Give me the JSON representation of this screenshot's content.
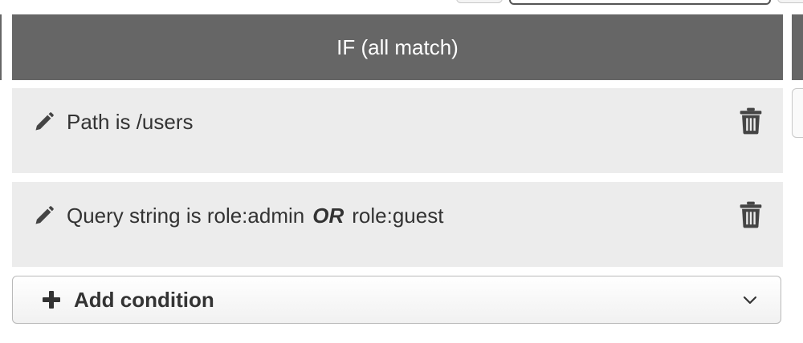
{
  "rule_block": {
    "header": "IF (all match)"
  },
  "conditions": [
    {
      "edit_icon": "pencil-icon",
      "text": "Path is /users",
      "delete_icon": "trash-icon"
    },
    {
      "edit_icon": "pencil-icon",
      "text_before": "Query string is role:admin",
      "operator": "OR",
      "text_after": "role:guest",
      "delete_icon": "trash-icon"
    }
  ],
  "add_condition": {
    "icon": "plus-icon",
    "label": "Add condition",
    "dropdown_icon": "chevron-down-icon"
  },
  "colors": {
    "header_bg": "#666666",
    "condition_bg": "#ececec",
    "text": "#333333"
  }
}
